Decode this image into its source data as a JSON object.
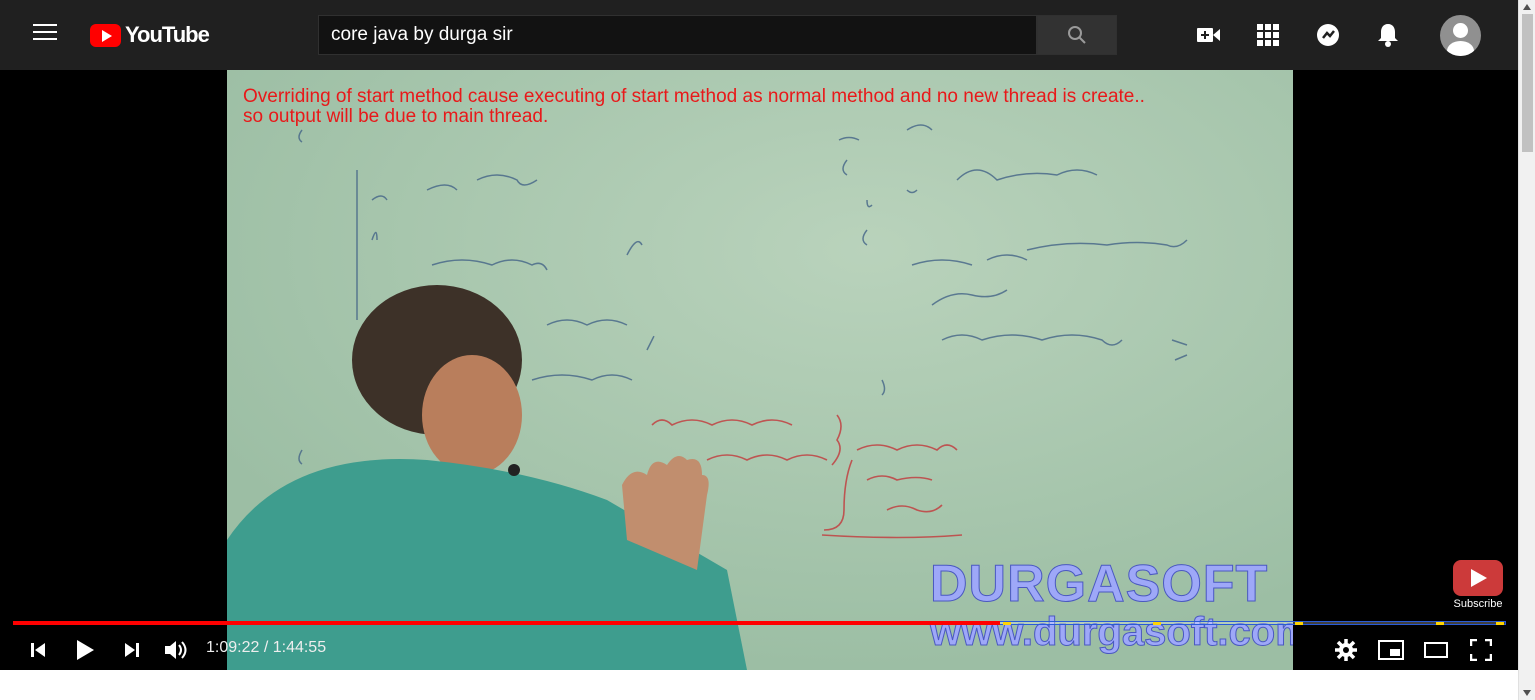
{
  "header": {
    "logo_text": "YouTube",
    "search_value": "core java by durga sir",
    "icons": [
      "menu-icon",
      "search-icon",
      "create-video-icon",
      "apps-icon",
      "messages-icon",
      "notifications-icon",
      "account-avatar"
    ]
  },
  "video": {
    "caption_line1": "Overriding of start method cause executing of start method as normal method and no new thread is create..",
    "caption_line2": "so output will be due to main thread.",
    "watermark_line1": "DURGASOFT",
    "watermark_line2": "www.durgasoft.com",
    "subscribe_label": "Subscribe"
  },
  "player": {
    "time_display": "1:09:22 / 1:44:55",
    "progress_fraction": 0.661,
    "accent_color": "#ff0000",
    "marker_color": "#ffd400"
  },
  "colors": {
    "topbar": "#202020",
    "caption": "#e8191a",
    "whiteboard": "#a7c6ad"
  }
}
